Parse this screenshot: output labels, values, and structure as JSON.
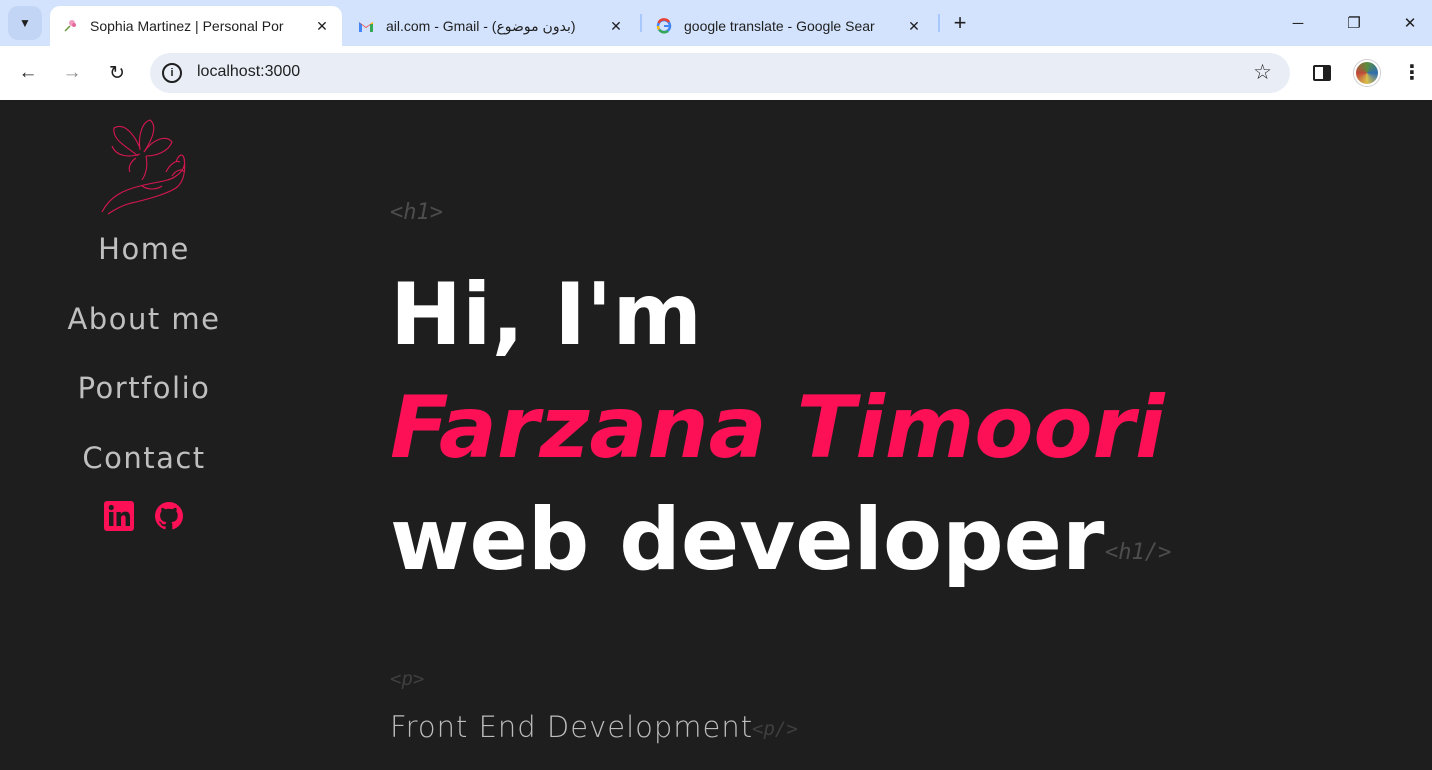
{
  "browser": {
    "tabs": [
      {
        "title": "Sophia Martinez | Personal Por",
        "favicon": "flower-favicon",
        "active": true
      },
      {
        "title": "ail.com - Gmail - (بدون موضوع)",
        "favicon": "gmail-icon",
        "active": false
      },
      {
        "title": "google translate - Google Sear",
        "favicon": "google-icon",
        "active": false
      }
    ],
    "url": "localhost:3000",
    "new_tab_symbol": "+",
    "window_controls": {
      "minimize": "─",
      "maximize": "❐",
      "close": "✕"
    }
  },
  "sidebar": {
    "nav": [
      "Home",
      "About me",
      "Portfolio",
      "Contact"
    ],
    "social": [
      "linkedin-icon",
      "github-icon"
    ]
  },
  "hero": {
    "open_tag": "<h1>",
    "greeting": "Hi, I'm",
    "name": "Farzana Timoori",
    "role": "web developer",
    "close_tag": "<h1/>"
  },
  "intro": {
    "open_tag": "<p>",
    "text": "Front End Development",
    "close_tag": "<p/>"
  },
  "colors": {
    "accent": "#fd1056",
    "background": "#1f1e1f",
    "nav_text": "#bfbfbf"
  }
}
